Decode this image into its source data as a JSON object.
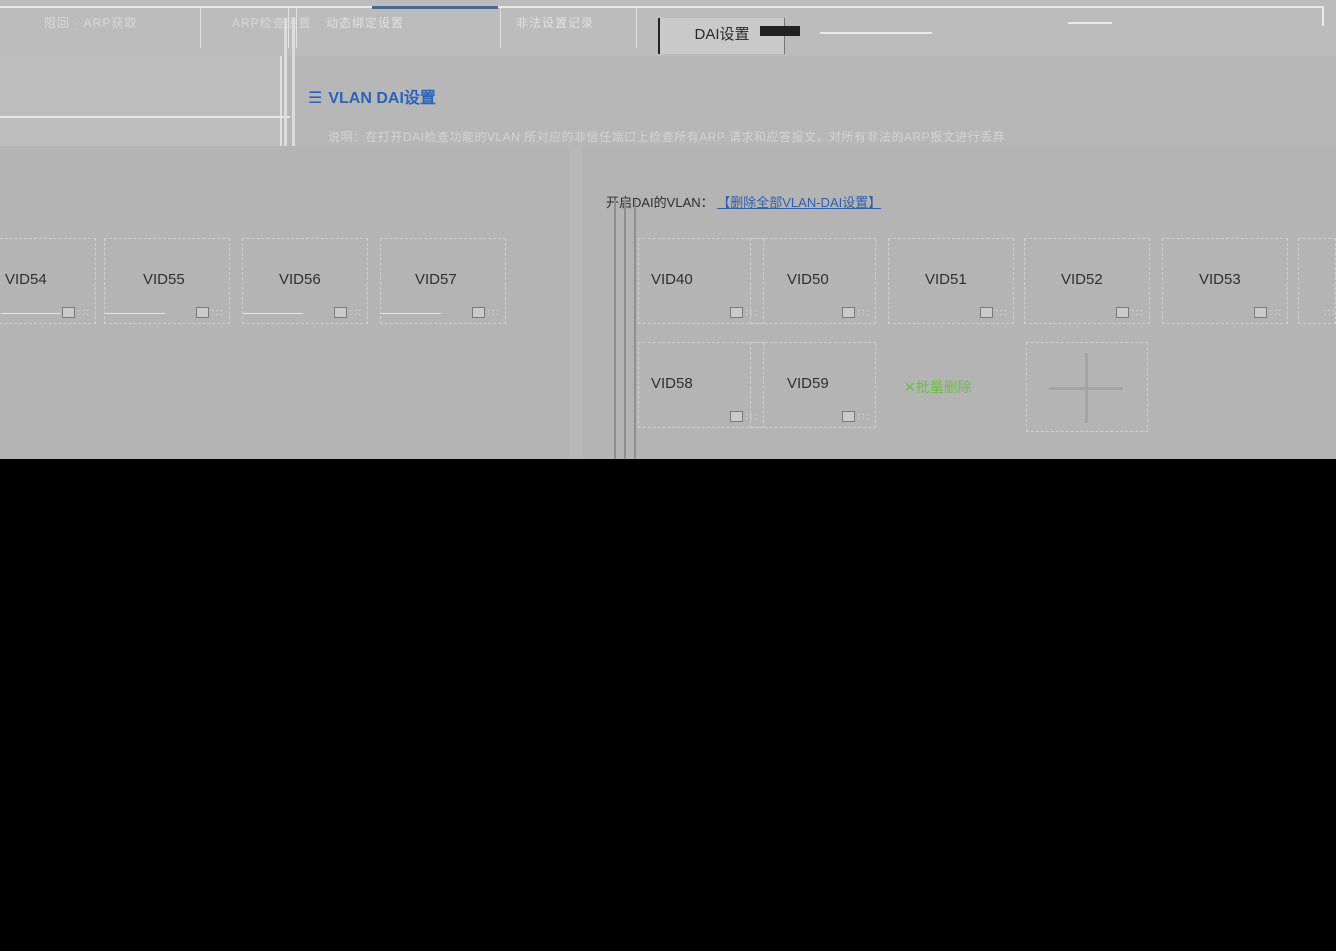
{
  "tabs": [
    {
      "label": "阻回 · ARP获取"
    },
    {
      "label": "ARP检查设置"
    },
    {
      "label": "动态绑定设置"
    },
    {
      "label": "非法设置记录"
    },
    {
      "label": "DAI设置"
    }
  ],
  "header": {
    "title": "VLAN DAI设置",
    "title_icon": "menu-icon",
    "description": "说明：在打开DAI检查功能的VLAN 所对应的非信任端口上检查所有ARP 请求和应答报文，对所有非法的ARP报文进行丢弃"
  },
  "panel": {
    "enabled_label": "开启DAI的VLAN：",
    "delete_all_link": "【删除全部VLAN-DAI设置】"
  },
  "left_vids": [
    "VID54",
    "VID55",
    "VID56",
    "VID57"
  ],
  "right_vids_row1": [
    "VID40",
    "VID50",
    "VID51",
    "VID52",
    "VID53"
  ],
  "right_vids_row2": [
    "VID58",
    "VID59"
  ],
  "batch_delete_label": "✕批量删除",
  "accent_colors": {
    "title_blue": "#2b63b8",
    "delete_green": "#6cc04a",
    "active_tab_bar": "#4a6c8c"
  }
}
